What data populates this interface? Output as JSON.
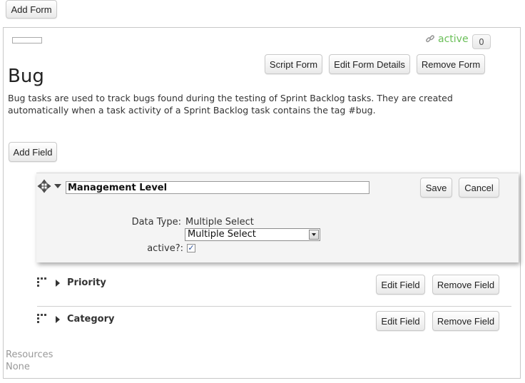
{
  "toolbar": {
    "add_form_label": "Add Form"
  },
  "form": {
    "status_label": "active",
    "count": "0",
    "title": "Bug",
    "description": "Bug tasks are used to track bugs found during the testing of Sprint Backlog tasks. They are created automatically when a task activity of a Sprint Backlog task contains the tag #bug.",
    "buttons": {
      "script_form": "Script Form",
      "edit_details": "Edit Form Details",
      "remove_form": "Remove Form"
    },
    "add_field_label": "Add Field"
  },
  "editor": {
    "field_name_value": "Management Level",
    "save_label": "Save",
    "cancel_label": "Cancel",
    "data_type_label": "Data Type:",
    "data_type_value": "Multiple Select",
    "data_type_selected": "Multiple Select",
    "active_label": "active?:",
    "active_checked": true
  },
  "fields": [
    {
      "name": "Priority",
      "edit_label": "Edit Field",
      "remove_label": "Remove Field"
    },
    {
      "name": "Category",
      "edit_label": "Edit Field",
      "remove_label": "Remove Field"
    }
  ],
  "resources": {
    "label": "Resources",
    "value": "None"
  },
  "colors": {
    "active_green": "#6abf58",
    "panel_border": "#c8c8c8"
  }
}
